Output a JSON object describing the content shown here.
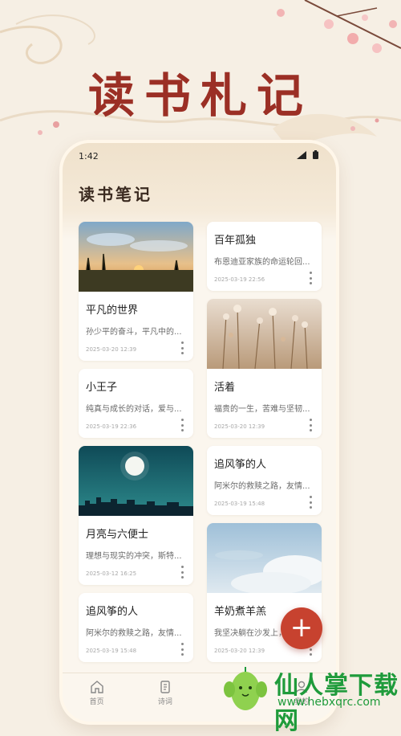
{
  "promo": {
    "title": "读书札记"
  },
  "status_bar": {
    "time": "1:42"
  },
  "page": {
    "title": "读书笔记"
  },
  "cards_left": [
    {
      "title": "平凡的世界",
      "desc": "孙少平的奋斗，平凡中的...",
      "date": "2025-03-20 12:39",
      "image": "sunset-field"
    },
    {
      "title": "小王子",
      "desc": "纯真与成长的对话，爱与...",
      "date": "2025-03-19 22:36",
      "image": ""
    },
    {
      "title": "月亮与六便士",
      "desc": "理想与现实的冲突，斯特...",
      "date": "2025-03-12 16:25",
      "image": "night-moon-city"
    },
    {
      "title": "追风筝的人",
      "desc": "阿米尔的救赎之路，友情...",
      "date": "2025-03-19 15:48",
      "image": ""
    }
  ],
  "cards_right": [
    {
      "title": "百年孤独",
      "desc": "布恩迪亚家族的命运轮回...",
      "date": "2025-03-19 22:56",
      "image": ""
    },
    {
      "title": "活着",
      "desc": "福贵的一生，苦难与坚韧...",
      "date": "2025-03-20 12:39",
      "image": "dried-flowers"
    },
    {
      "title": "追风筝的人",
      "desc": "阿米尔的救赎之路，友情...",
      "date": "2025-03-19 15:48",
      "image": ""
    },
    {
      "title": "羊奶煮羊羔",
      "desc": "我坚决躺在沙发上，闻...",
      "date": "2025-03-20 12:39",
      "image": "sky-clouds"
    }
  ],
  "fab": {
    "icon": "plus-icon",
    "label": "+"
  },
  "tabs": [
    {
      "label": "首页",
      "icon": "home-icon"
    },
    {
      "label": "诗词",
      "icon": "scroll-icon"
    },
    {
      "label": "",
      "icon": ""
    },
    {
      "label": "我的",
      "icon": "user-icon"
    }
  ],
  "watermark": {
    "line1": "仙人掌下载网",
    "line2": "www.hebxqrc.com"
  },
  "colors": {
    "accent": "#c7422f",
    "title_red": "#9b2f25",
    "background": "#f6efe4"
  }
}
